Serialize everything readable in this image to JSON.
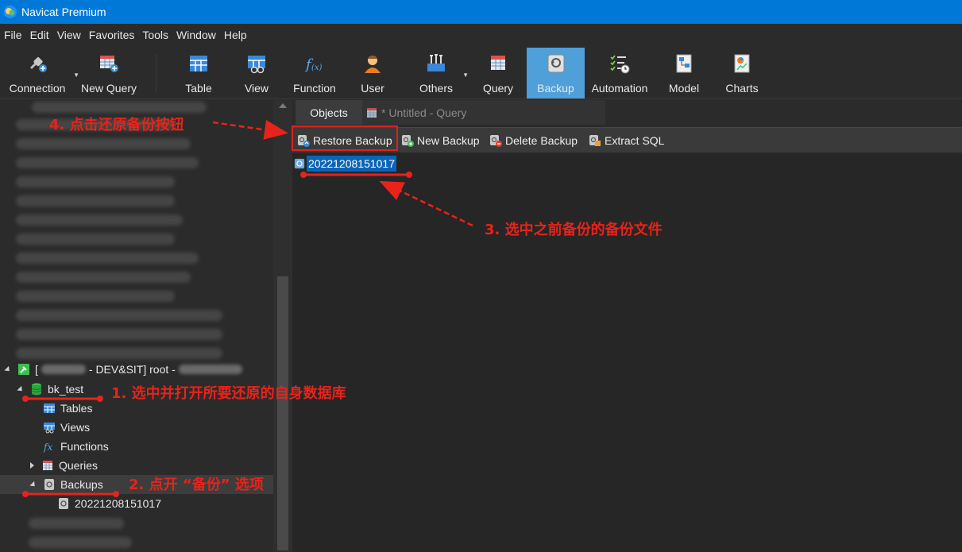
{
  "window": {
    "title": "Navicat Premium"
  },
  "menu": [
    "File",
    "Edit",
    "View",
    "Favorites",
    "Tools",
    "Window",
    "Help"
  ],
  "toolbar": {
    "connection": "Connection",
    "new_query": "New Query",
    "table": "Table",
    "view": "View",
    "function": "Function",
    "user": "User",
    "others": "Others",
    "query": "Query",
    "backup": "Backup",
    "automation": "Automation",
    "model": "Model",
    "charts": "Charts",
    "active": "Backup"
  },
  "tabs": {
    "objects": "Objects",
    "query": "* Untitled - Query"
  },
  "subtoolbar": {
    "restore": "Restore Backup",
    "new": "New Backup",
    "delete": "Delete Backup",
    "extract": "Extract SQL"
  },
  "backup_files": [
    "20221208151017"
  ],
  "tree": {
    "connection_prefix": "[",
    "connection_suffix": "- DEV&SIT] root -",
    "database": "bk_test",
    "tables": "Tables",
    "views": "Views",
    "functions": "Functions",
    "queries": "Queries",
    "backups": "Backups",
    "backup_child": "20221208151017"
  },
  "annotations": {
    "step1": "1. 选中并打开所要还原的自身数据库",
    "step2": "2. 点开 “备份” 选项",
    "step3": "3. 选中之前备份的备份文件",
    "step4": "4. 点击还原备份按钮"
  },
  "colors": {
    "accent": "#0078d7",
    "annotation": "#e8231a",
    "selection": "#0a64b8",
    "active_tool": "#4f9fd8"
  }
}
